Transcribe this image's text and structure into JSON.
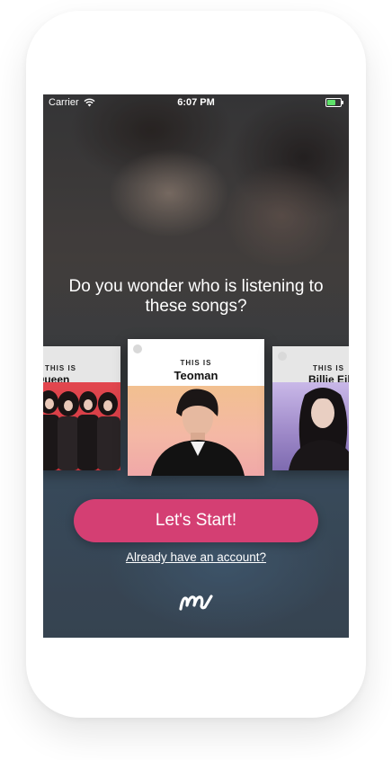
{
  "status_bar": {
    "carrier": "Carrier",
    "time": "6:07 PM",
    "wifi_icon": "wifi-icon",
    "battery_icon": "battery-charging-icon"
  },
  "onboarding": {
    "headline": "Do you wonder who is listening to these songs?",
    "cards": [
      {
        "prefix": "THIS IS",
        "artist": "Queen"
      },
      {
        "prefix": "THIS IS",
        "artist": "Teoman"
      },
      {
        "prefix": "THIS IS",
        "artist": "Billie Eili"
      }
    ],
    "start_button": "Let's Start!",
    "account_link": "Already have an account?",
    "logo_icon": "m-logo-icon"
  },
  "colors": {
    "accent": "#d43f73",
    "text": "#ffffff"
  }
}
